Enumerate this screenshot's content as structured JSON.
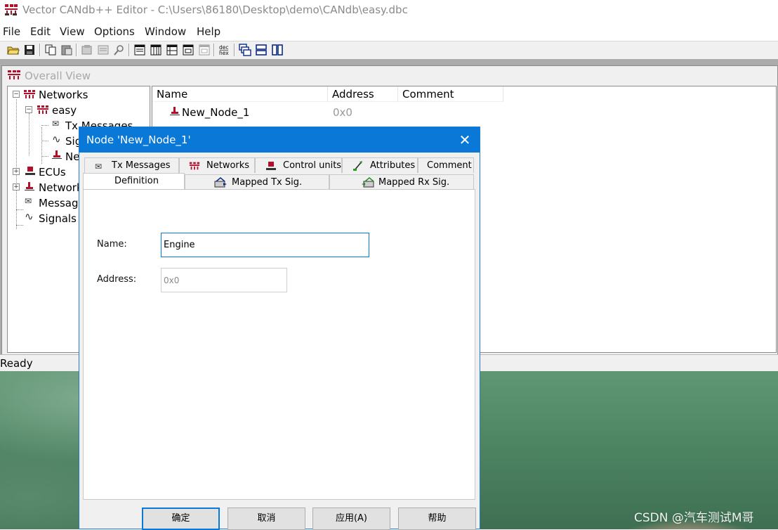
{
  "window": {
    "title": "Vector CANdb++ Editor - C:\\Users\\86180\\Desktop\\demo\\CANdb\\easy.dbc"
  },
  "menu": [
    "File",
    "Edit",
    "View",
    "Options",
    "Window",
    "Help"
  ],
  "toolbar": {
    "icons": [
      "open-icon",
      "save-icon",
      "copy-icon",
      "paste-icon",
      "properties-icon",
      "details-icon",
      "search-icon",
      "view-list-icon",
      "view-columns-icon",
      "view-table-icon",
      "view-grid-icon",
      "view-disabled-icon",
      "dec-hex-icon",
      "tile-cascade-icon",
      "tile-horizontal-icon",
      "tile-vertical-icon"
    ],
    "dec_hex_label": "dec hex"
  },
  "overall_view": {
    "title": "Overall View",
    "tree": {
      "networks": "Networks",
      "easy": "easy",
      "tx_messages": "Tx Messages",
      "signals_partial": "Sig",
      "node_partial": "Ne",
      "ecus": "ECUs",
      "network_nodes_partial": "Network",
      "messages_partial": "Message",
      "signals": "Signals"
    },
    "list": {
      "columns": [
        "Name",
        "Address",
        "Comment"
      ],
      "rows": [
        {
          "name": "New_Node_1",
          "address": "0x0",
          "comment": ""
        }
      ]
    }
  },
  "status": {
    "text": "Ready"
  },
  "dialog": {
    "title": "Node 'New_Node_1'",
    "tabs_row1": [
      "Tx Messages",
      "Networks",
      "Control units",
      "Attributes",
      "Comment"
    ],
    "tabs_row2": [
      "Definition",
      "Mapped Tx Sig.",
      "Mapped Rx Sig."
    ],
    "active_tab": "Definition",
    "fields": {
      "name_label": "Name:",
      "name_value": "Engine",
      "address_label": "Address:",
      "address_value": "0x0"
    },
    "buttons": {
      "ok": "确定",
      "cancel": "取消",
      "apply": "应用(A)",
      "help": "帮助"
    }
  },
  "watermark": "CSDN @汽车测试M哥",
  "colors": {
    "accent": "#0a78d7",
    "node_icon": "#b0102a",
    "network_icon": "#b0102a"
  }
}
